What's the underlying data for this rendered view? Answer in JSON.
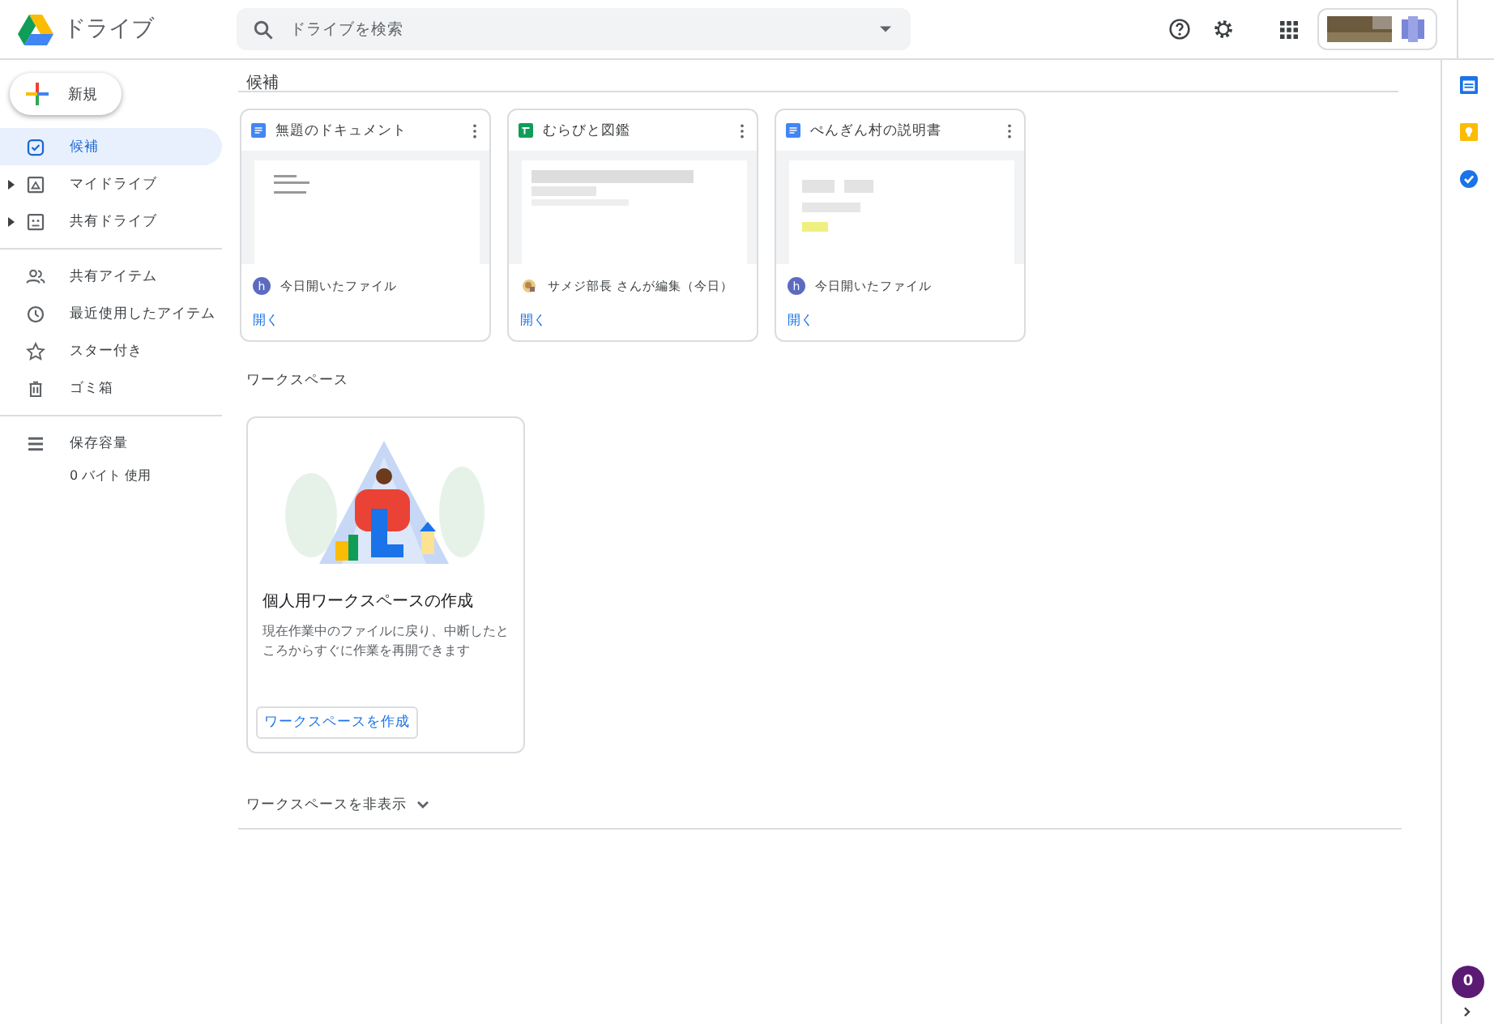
{
  "header": {
    "app_name": "ドライブ",
    "search": {
      "placeholder": "ドライブを検索"
    }
  },
  "sidebar": {
    "new_button": "新規",
    "groups": [
      [
        {
          "label": "候補",
          "selected": true,
          "expandable": false
        },
        {
          "label": "マイドライブ",
          "selected": false,
          "expandable": true
        },
        {
          "label": "共有ドライブ",
          "selected": false,
          "expandable": true
        }
      ],
      [
        {
          "label": "共有アイテム",
          "selected": false,
          "expandable": false
        },
        {
          "label": "最近使用したアイテム",
          "selected": false,
          "expandable": false
        },
        {
          "label": "スター付き",
          "selected": false,
          "expandable": false
        },
        {
          "label": "ゴミ箱",
          "selected": false,
          "expandable": false
        }
      ],
      [
        {
          "label": "保存容量",
          "selected": false,
          "expandable": false
        }
      ]
    ],
    "storage_usage": "0 バイト 使用"
  },
  "suggestions": {
    "title": "候補",
    "files": [
      {
        "name": "無題のドキュメント",
        "kind": "doc",
        "activity": "今日開いたファイル",
        "avatar": {
          "kind": "letter",
          "letter": "h"
        },
        "action": "開く"
      },
      {
        "name": "むらびと図鑑",
        "kind": "sheet",
        "activity": "サメジ部長 さんが編集（今日）",
        "action": "開く"
      },
      {
        "name": "ぺんぎん村の説明書",
        "kind": "doc",
        "activity": "今日開いたファイル",
        "avatar": {
          "kind": "letter",
          "letter": "h"
        },
        "action": "開く"
      }
    ]
  },
  "workspaces": {
    "title": "ワークスペース",
    "card": {
      "title": "個人用ワークスペースの作成",
      "description": "現在作業中のファイルに戻り、中断したところからすぐに作業を再開できます",
      "button": "ワークスペースを作成"
    },
    "hide_toggle": "ワークスペースを非表示"
  },
  "side_panel": {
    "badge": "0"
  }
}
